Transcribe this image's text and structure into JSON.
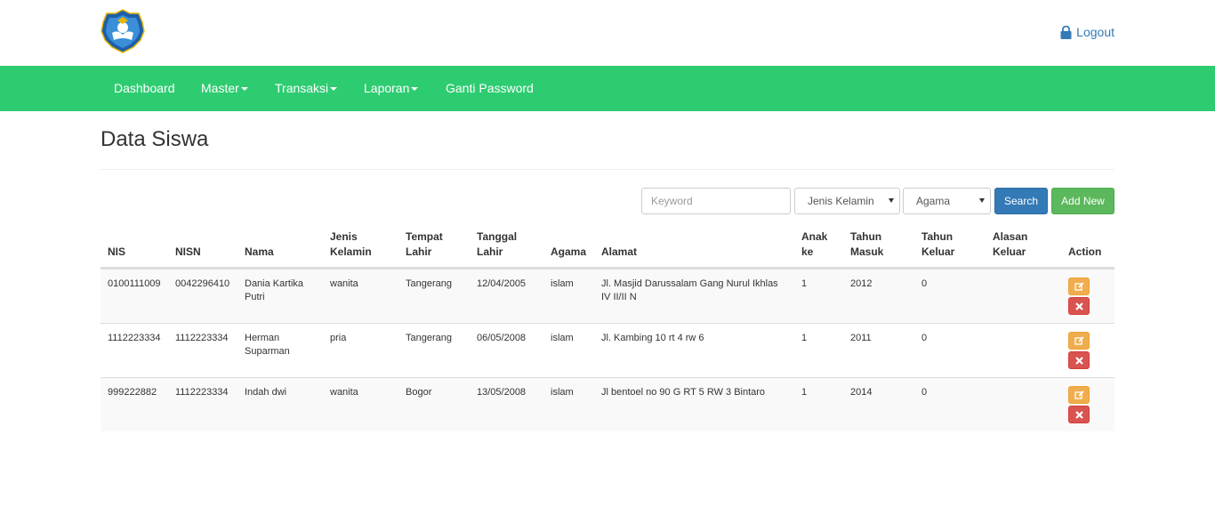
{
  "header": {
    "logout_label": "Logout",
    "logo_icon": "tut-wuri-handayani-logo"
  },
  "navbar": {
    "items": [
      {
        "label": "Dashboard",
        "dropdown": false
      },
      {
        "label": "Master",
        "dropdown": true
      },
      {
        "label": "Transaksi",
        "dropdown": true
      },
      {
        "label": "Laporan",
        "dropdown": true
      },
      {
        "label": "Ganti Password",
        "dropdown": false
      }
    ],
    "color": "#2ecc71"
  },
  "page": {
    "title": "Data Siswa"
  },
  "filters": {
    "keyword_placeholder": "Keyword",
    "gender_select": "Jenis Kelamin",
    "religion_select": "Agama",
    "search_label": "Search",
    "add_label": "Add New"
  },
  "table": {
    "headers": {
      "nis": [
        "NIS"
      ],
      "nisn": [
        "NISN"
      ],
      "nama": [
        "Nama"
      ],
      "jk": [
        "Jenis",
        "Kelamin"
      ],
      "tempat": [
        "Tempat",
        "Lahir"
      ],
      "tanggal": [
        "Tanggal",
        "Lahir"
      ],
      "agama": [
        "Agama"
      ],
      "alamat": [
        "Alamat"
      ],
      "anak": [
        "Anak",
        "ke"
      ],
      "masuk": [
        "Tahun",
        "Masuk"
      ],
      "keluar": [
        "Tahun",
        "Keluar"
      ],
      "alasan": [
        "Alasan",
        "Keluar"
      ],
      "action": [
        "Action"
      ]
    },
    "rows": [
      {
        "nis": "0100111009",
        "nisn": "0042296410",
        "nama": [
          "Dania Kartika",
          "Putri"
        ],
        "jk": "wanita",
        "tempat": "Tangerang",
        "tanggal": "12/04/2005",
        "agama": "islam",
        "alamat": [
          "Jl. Masjid Darussalam Gang Nurul Ikhlas",
          "IV II/II N"
        ],
        "anak": "1",
        "masuk": "2012",
        "keluar": "0",
        "alasan": ""
      },
      {
        "nis": "1112223334",
        "nisn": "1112223334",
        "nama": [
          "Herman",
          "Suparman"
        ],
        "jk": "pria",
        "tempat": "Tangerang",
        "tanggal": "06/05/2008",
        "agama": "islam",
        "alamat": [
          "Jl. Kambing 10 rt 4 rw 6"
        ],
        "anak": "1",
        "masuk": "2011",
        "keluar": "0",
        "alasan": ""
      },
      {
        "nis": "999222882",
        "nisn": "1112223334",
        "nama": [
          "Indah dwi"
        ],
        "jk": "wanita",
        "tempat": "Bogor",
        "tanggal": "13/05/2008",
        "agama": "islam",
        "alamat": [
          "Jl bentoel no 90 G RT 5 RW 3 Bintaro"
        ],
        "anak": "1",
        "masuk": "2014",
        "keluar": "0",
        "alasan": ""
      }
    ]
  }
}
